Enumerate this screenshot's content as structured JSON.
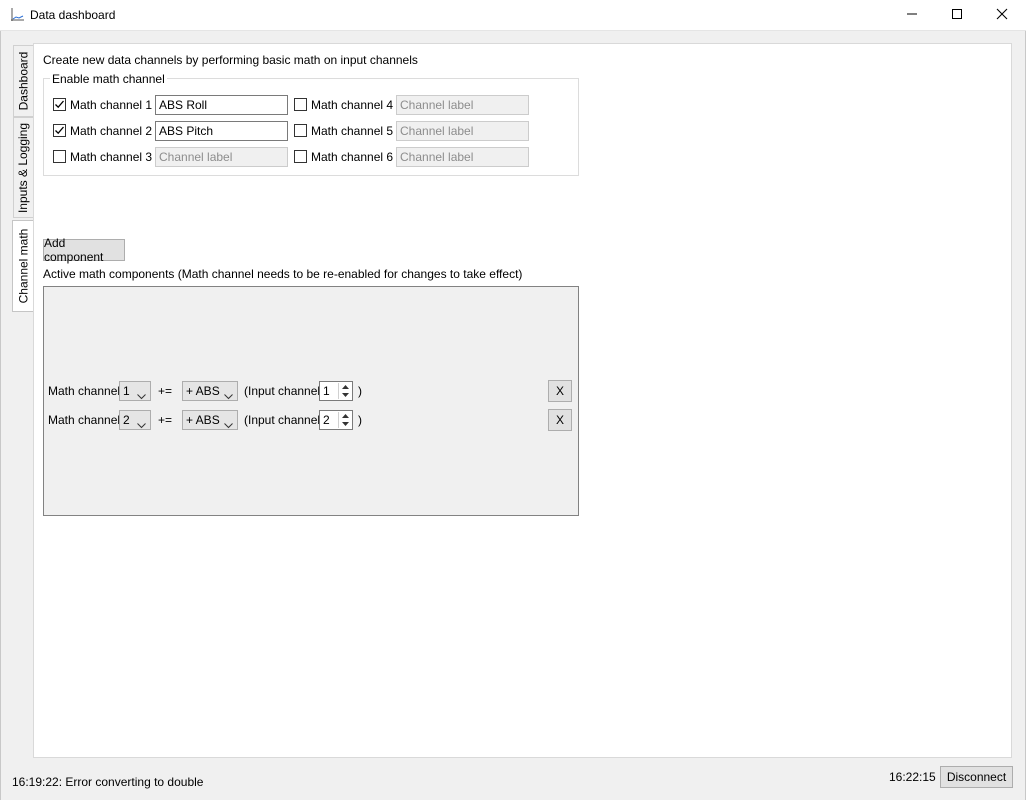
{
  "window": {
    "title": "Data dashboard",
    "icon": "chart-icon",
    "controls": [
      "minimize-icon",
      "maximize-icon",
      "close-icon"
    ]
  },
  "tabs": [
    {
      "label": "Dashboard",
      "active": false
    },
    {
      "label": "Inputs & Logging",
      "active": false
    },
    {
      "label": "Channel math",
      "active": true
    }
  ],
  "channel_math": {
    "description": "Create new data channels by performing basic math on input channels",
    "group_title": "Enable math channel",
    "channels": [
      {
        "label": "Math channel 1",
        "checked": true,
        "value": "ABS Roll",
        "placeholder": "Channel label"
      },
      {
        "label": "Math channel 2",
        "checked": true,
        "value": "ABS Pitch",
        "placeholder": "Channel label"
      },
      {
        "label": "Math channel 3",
        "checked": false,
        "value": "",
        "placeholder": "Channel label"
      },
      {
        "label": "Math channel 4",
        "checked": false,
        "value": "",
        "placeholder": "Channel label"
      },
      {
        "label": "Math channel 5",
        "checked": false,
        "value": "",
        "placeholder": "Channel label"
      },
      {
        "label": "Math channel 6",
        "checked": false,
        "value": "",
        "placeholder": "Channel label"
      }
    ],
    "add_component_label": "Add component",
    "components_caption": "Active math components (Math channel needs to be re-enabled for changes to take effect)",
    "components": [
      {
        "label": "Math channel",
        "channel": "1",
        "operator": "+=",
        "operation": "+ ABS",
        "input_label": "(Input channel",
        "input_channel": "1",
        "close_paren": ")",
        "remove_label": "X"
      },
      {
        "label": "Math channel",
        "channel": "2",
        "operator": "+=",
        "operation": "+ ABS",
        "input_label": "(Input channel",
        "input_channel": "2",
        "close_paren": ")",
        "remove_label": "X"
      }
    ]
  },
  "status": {
    "message": "16:19:22: Error converting to double",
    "time": "16:22:15",
    "disconnect_label": "Disconnect"
  }
}
